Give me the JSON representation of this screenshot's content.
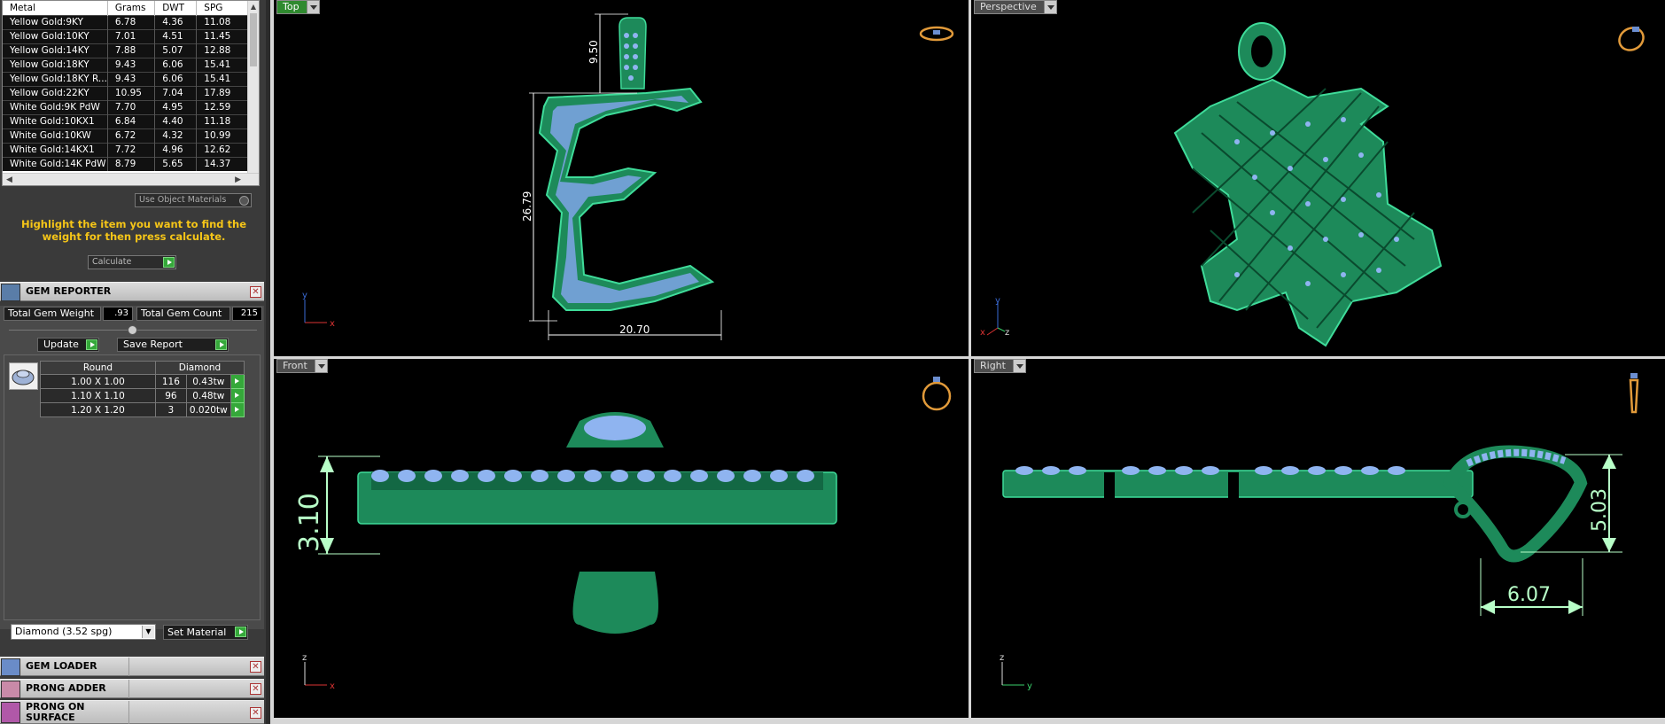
{
  "metal_table": {
    "columns": [
      "Metal",
      "Grams",
      "DWT",
      "SPG"
    ],
    "rows": [
      [
        "Yellow Gold:9KY",
        "6.78",
        "4.36",
        "11.08"
      ],
      [
        "Yellow Gold:10KY",
        "7.01",
        "4.51",
        "11.45"
      ],
      [
        "Yellow Gold:14KY",
        "7.88",
        "5.07",
        "12.88"
      ],
      [
        "Yellow Gold:18KY",
        "9.43",
        "6.06",
        "15.41"
      ],
      [
        "Yellow Gold:18KY R...",
        "9.43",
        "6.06",
        "15.41"
      ],
      [
        "Yellow Gold:22KY",
        "10.95",
        "7.04",
        "17.89"
      ],
      [
        "White Gold:9K PdW",
        "7.70",
        "4.95",
        "12.59"
      ],
      [
        "White Gold:10KX1",
        "6.84",
        "4.40",
        "11.18"
      ],
      [
        "White Gold:10KW",
        "6.72",
        "4.32",
        "10.99"
      ],
      [
        "White Gold:14KX1",
        "7.72",
        "4.96",
        "12.62"
      ],
      [
        "White Gold:14K PdW",
        "8.79",
        "5.65",
        "14.37"
      ]
    ]
  },
  "use_object_materials": "Use Object Materials",
  "hint": "Highlight the item you want to find the weight for then press calculate.",
  "calculate_label": "Calculate",
  "gem_reporter": {
    "title": "GEM REPORTER",
    "total_weight_label": "Total Gem Weight",
    "total_weight_value": ".93",
    "total_count_label": "Total Gem Count",
    "total_count_value": "215",
    "update_label": "Update",
    "save_report_label": "Save Report",
    "table_headers": [
      "Round",
      "Diamond"
    ],
    "rows": [
      {
        "size": "1.00 X 1.00",
        "count": "116",
        "weight": "0.43tw"
      },
      {
        "size": "1.10 X 1.10",
        "count": "96",
        "weight": "0.48tw"
      },
      {
        "size": "1.20 X 1.20",
        "count": "3",
        "weight": "0.020tw"
      }
    ],
    "material_select": "Diamond     (3.52 spg)",
    "set_material_label": "Set Material"
  },
  "panels": {
    "gem_loader": "GEM LOADER",
    "prong_adder": "PRONG ADDER",
    "prong_on_surface": "PRONG ON SURFACE"
  },
  "viewports": {
    "top": {
      "label": "Top",
      "dim_height": "26.79",
      "dim_bail": "9.50",
      "dim_width": "20.70",
      "axis_x": "x",
      "axis_y": "y"
    },
    "perspective": {
      "label": "Perspective",
      "axis_x": "x",
      "axis_y": "y",
      "axis_z": "z"
    },
    "front": {
      "label": "Front",
      "dim_thickness": "3.10",
      "axis_x": "x",
      "axis_z": "z"
    },
    "right": {
      "label": "Right",
      "dim_height": "5.03",
      "dim_width": "6.07",
      "axis_y": "y",
      "axis_z": "z"
    }
  },
  "colors": {
    "metal": "#1d8a5a",
    "stone": "#8fb4f0",
    "accent": "#2f8a2f",
    "hint": "#f5c518"
  }
}
